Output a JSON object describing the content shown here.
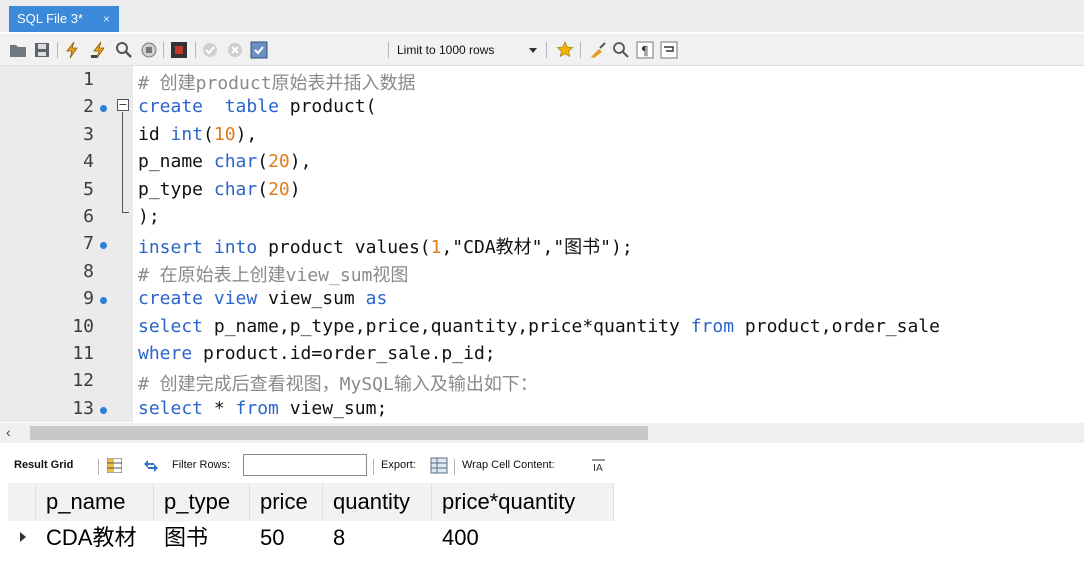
{
  "tab": {
    "title": "SQL File 3*",
    "close": "×"
  },
  "toolbar": {
    "limit_label": "Limit to 1000 rows"
  },
  "editor": {
    "lines": [
      {
        "n": "1",
        "parts": [
          [
            "cm",
            "# 创建product原始表并插入数据"
          ]
        ]
      },
      {
        "n": "2",
        "parts": [
          [
            "kw",
            "create"
          ],
          [
            "",
            "  "
          ],
          [
            "kw",
            "table"
          ],
          [
            "",
            " product("
          ]
        ]
      },
      {
        "n": "3",
        "parts": [
          [
            "",
            "id "
          ],
          [
            "kw",
            "int"
          ],
          [
            "",
            "("
          ],
          [
            "num",
            "10"
          ],
          [
            "",
            "),"
          ]
        ]
      },
      {
        "n": "4",
        "parts": [
          [
            "",
            "p_name "
          ],
          [
            "kw",
            "char"
          ],
          [
            "",
            "("
          ],
          [
            "num",
            "20"
          ],
          [
            "",
            "),"
          ]
        ]
      },
      {
        "n": "5",
        "parts": [
          [
            "",
            "p_type "
          ],
          [
            "kw",
            "char"
          ],
          [
            "",
            "("
          ],
          [
            "num",
            "20"
          ],
          [
            "",
            ")"
          ]
        ]
      },
      {
        "n": "6",
        "parts": [
          [
            "",
            ");"
          ]
        ]
      },
      {
        "n": "7",
        "parts": [
          [
            "kw",
            "insert"
          ],
          [
            "",
            " "
          ],
          [
            "kw",
            "into"
          ],
          [
            "",
            " product values("
          ],
          [
            "num",
            "1"
          ],
          [
            "",
            ",\"CDA教材\",\"图书\");"
          ]
        ]
      },
      {
        "n": "8",
        "parts": [
          [
            "cm",
            "# 在原始表上创建view_sum视图"
          ]
        ]
      },
      {
        "n": "9",
        "parts": [
          [
            "kw",
            "create"
          ],
          [
            "",
            " "
          ],
          [
            "kw",
            "view"
          ],
          [
            "",
            " view_sum "
          ],
          [
            "kw",
            "as"
          ]
        ]
      },
      {
        "n": "10",
        "parts": [
          [
            "kw",
            "select"
          ],
          [
            "",
            " p_name,p_type,price,quantity,price*quantity "
          ],
          [
            "kw",
            "from"
          ],
          [
            "",
            " product,order_sale"
          ]
        ]
      },
      {
        "n": "11",
        "parts": [
          [
            "kw",
            "where"
          ],
          [
            "",
            " product.id=order_sale.p_id;"
          ]
        ]
      },
      {
        "n": "12",
        "parts": [
          [
            "cm",
            "# 创建完成后查看视图，MySQL输入及输出如下："
          ]
        ]
      },
      {
        "n": "13",
        "parts": [
          [
            "kw",
            "select"
          ],
          [
            "",
            " * "
          ],
          [
            "kw",
            "from"
          ],
          [
            "",
            " view_sum;"
          ]
        ]
      }
    ],
    "dot_lines": [
      2,
      7,
      9,
      13
    ]
  },
  "result_toolbar": {
    "result_grid": "Result Grid",
    "filter_rows": "Filter Rows:",
    "export": "Export:",
    "wrap": "Wrap Cell Content:"
  },
  "result": {
    "columns": [
      "p_name",
      "p_type",
      "price",
      "quantity",
      "price*quantity"
    ],
    "rows": [
      [
        "CDA教材",
        "图书",
        "50",
        "8",
        "400"
      ]
    ]
  },
  "colors": {
    "keyword": "#2a65c9",
    "number": "#e07b1a",
    "comment": "#8a8a8a",
    "tab": "#3b89d8",
    "marker": "#2b7fd4"
  }
}
